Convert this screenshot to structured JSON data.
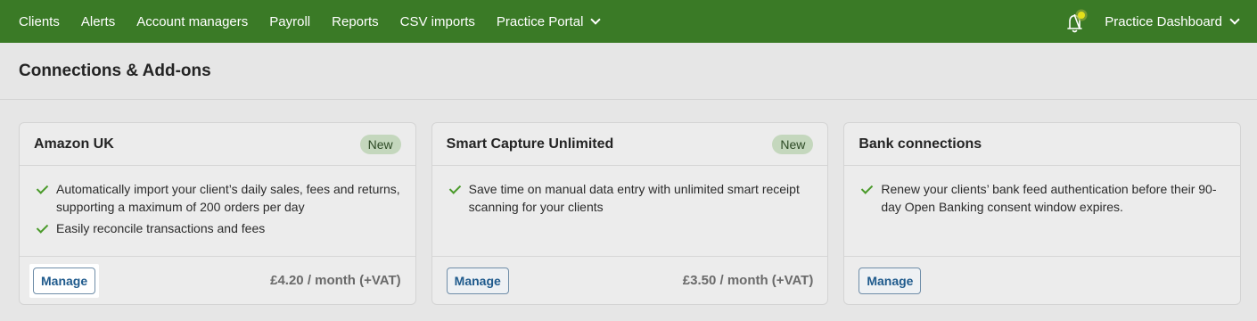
{
  "nav": {
    "items": [
      {
        "label": "Clients"
      },
      {
        "label": "Alerts"
      },
      {
        "label": "Account managers"
      },
      {
        "label": "Payroll"
      },
      {
        "label": "Reports"
      },
      {
        "label": "CSV imports"
      },
      {
        "label": "Practice Portal"
      }
    ],
    "right_label": "Practice Dashboard",
    "bell_icon": "bell-icon",
    "colors": {
      "bar": "#3a7a26",
      "notification_dot": "#e3e01a"
    }
  },
  "page": {
    "title": "Connections & Add-ons"
  },
  "cards": [
    {
      "title": "Amazon UK",
      "badge": "New",
      "features": [
        "Automatically import your client’s daily sales, fees and returns, supporting a maximum of 200 orders per day",
        "Easily reconcile transactions and fees"
      ],
      "button": "Manage",
      "price": "£4.20 / month (+VAT)"
    },
    {
      "title": "Smart Capture Unlimited",
      "badge": "New",
      "features": [
        "Save time on manual data entry with unlimited smart receipt scanning for your clients"
      ],
      "button": "Manage",
      "price": "£3.50 / month (+VAT)"
    },
    {
      "title": "Bank connections",
      "features": [
        "Renew your clients’ bank feed authentication before their 90-day Open Banking consent window expires."
      ],
      "button": "Manage"
    }
  ]
}
